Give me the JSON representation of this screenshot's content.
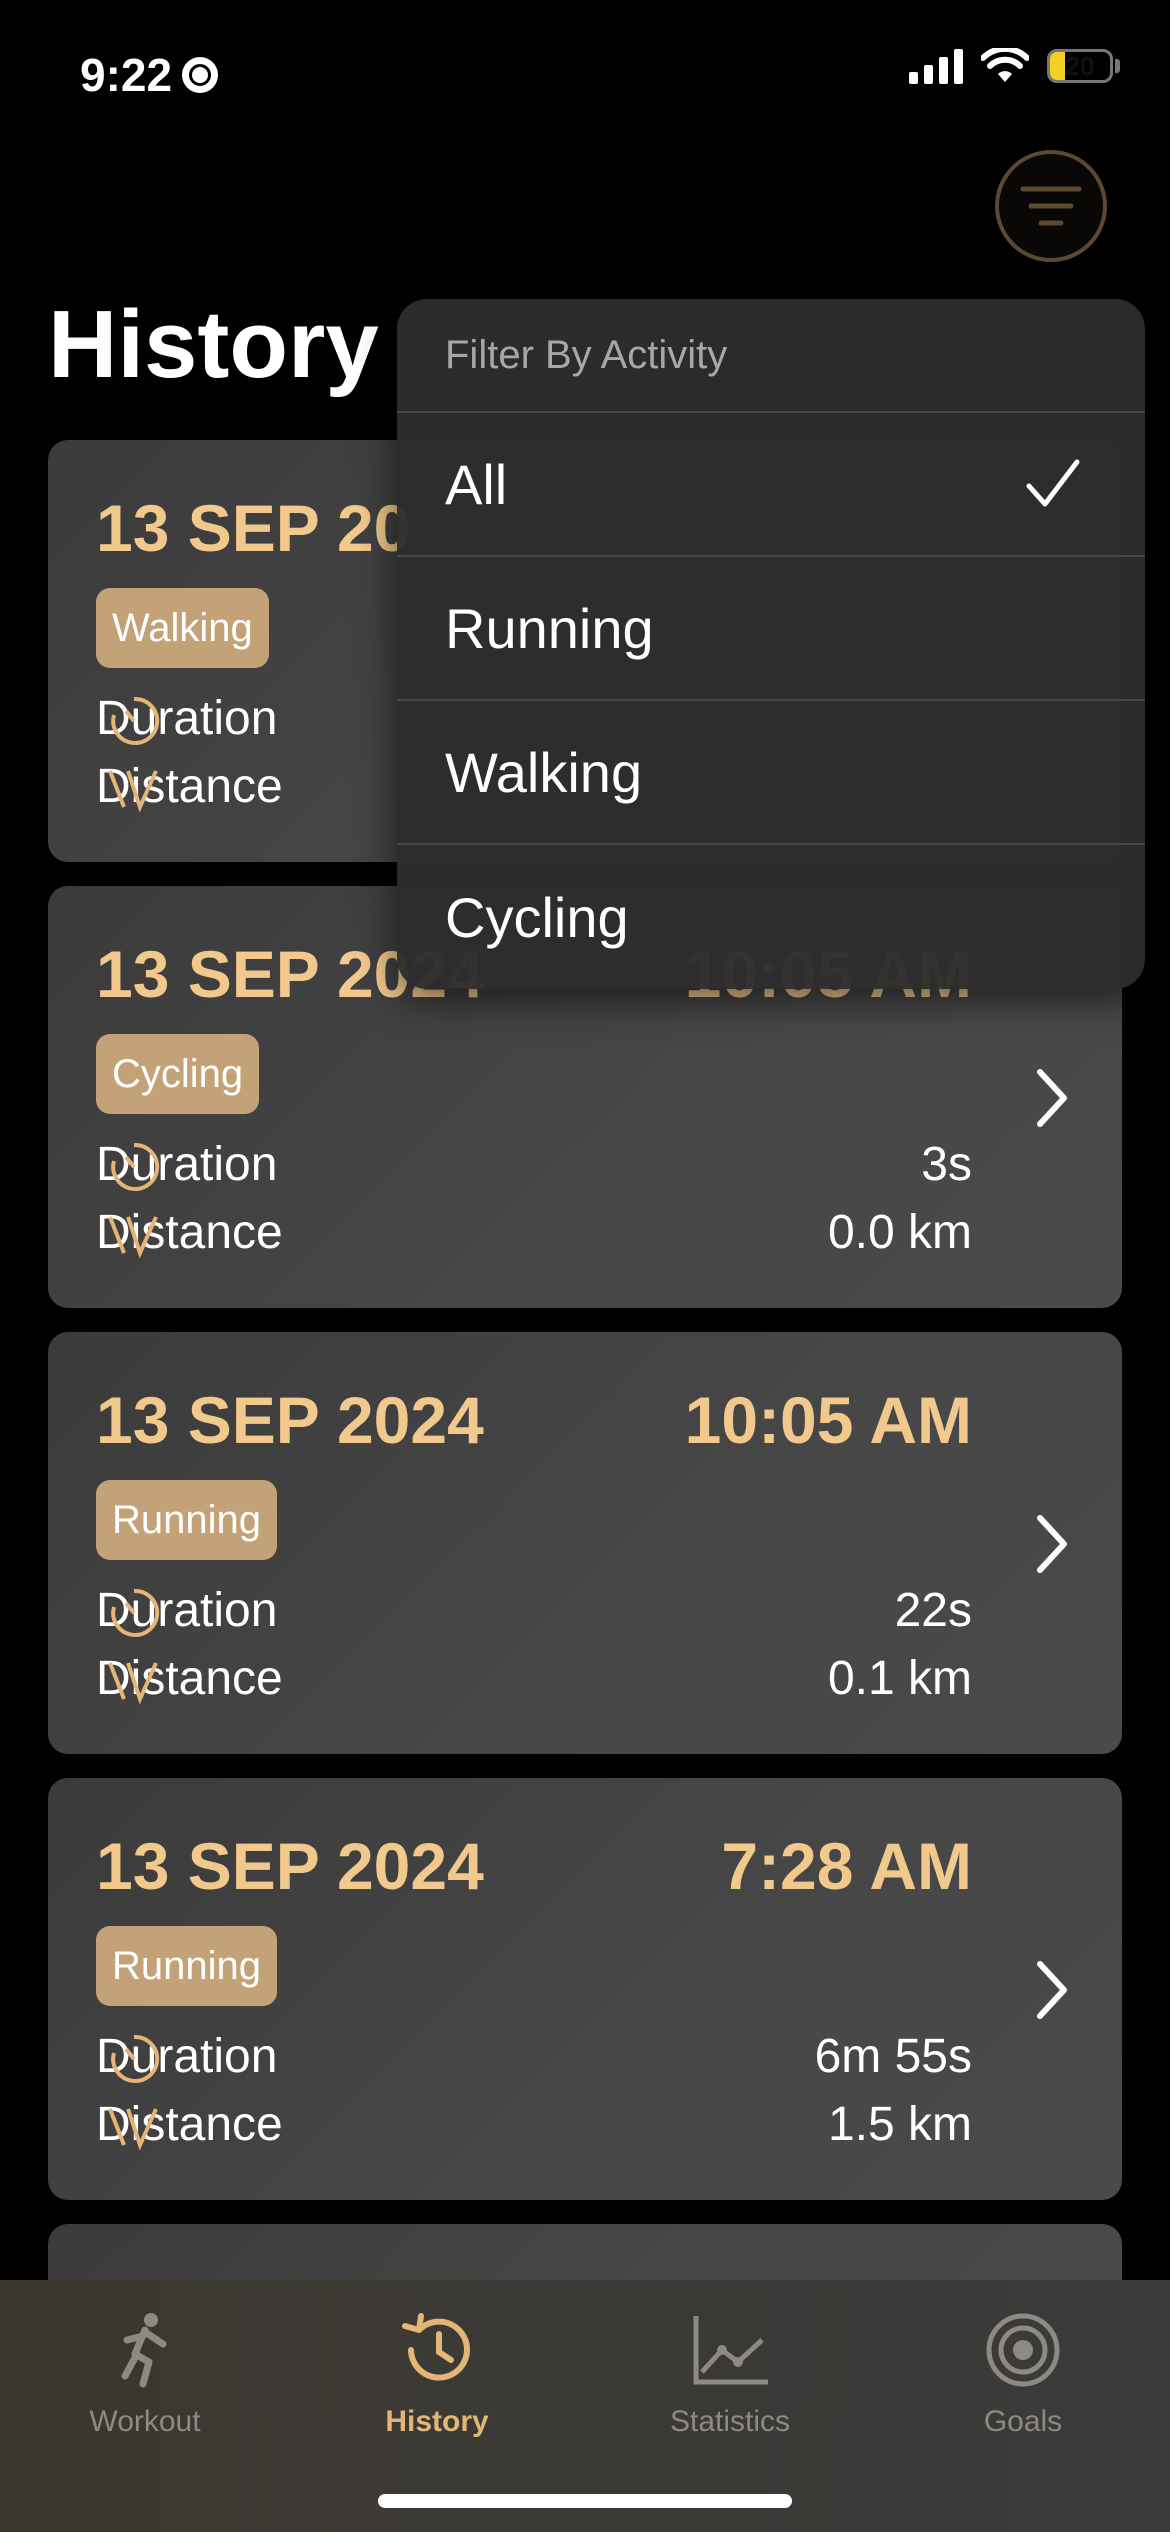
{
  "status_bar": {
    "time": "9:22",
    "battery": "20"
  },
  "page": {
    "title": "History"
  },
  "filter_menu": {
    "header": "Filter By Activity",
    "options": [
      "All",
      "Running",
      "Walking",
      "Cycling"
    ],
    "selected": "All"
  },
  "workouts": [
    {
      "date": "13 SEP 20",
      "time": "",
      "activity": "Walking",
      "duration_label": "Duration",
      "duration": "",
      "distance_label": "Distance",
      "distance": ""
    },
    {
      "date": "13 SEP 2024",
      "time": "10:05 AM",
      "activity": "Cycling",
      "duration_label": "Duration",
      "duration": "3s",
      "distance_label": "Distance",
      "distance": "0.0 km"
    },
    {
      "date": "13 SEP 2024",
      "time": "10:05 AM",
      "activity": "Running",
      "duration_label": "Duration",
      "duration": "22s",
      "distance_label": "Distance",
      "distance": "0.1 km"
    },
    {
      "date": "13 SEP 2024",
      "time": "7:28 AM",
      "activity": "Running",
      "duration_label": "Duration",
      "duration": "6m 55s",
      "distance_label": "Distance",
      "distance": "1.5 km"
    }
  ],
  "tabs": [
    {
      "label": "Workout",
      "icon": "running-person-icon"
    },
    {
      "label": "History",
      "icon": "history-clock-icon"
    },
    {
      "label": "Statistics",
      "icon": "line-chart-icon"
    },
    {
      "label": "Goals",
      "icon": "target-icon"
    }
  ],
  "active_tab": "History",
  "colors": {
    "accent": "#f2c98c",
    "badge": "#c2a276",
    "tab_active": "#e5b576"
  }
}
